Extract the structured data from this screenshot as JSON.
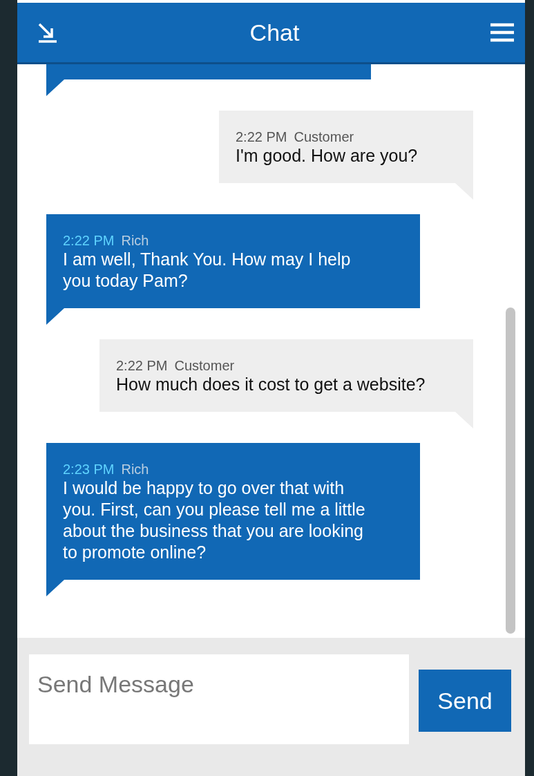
{
  "window": {
    "title": "Chat"
  },
  "messages": [
    {
      "kind": "customer",
      "time": "2:22 PM",
      "sender": "Customer",
      "text": "I'm good. How are you?"
    },
    {
      "kind": "agent",
      "time": "2:22 PM",
      "sender": "Rich",
      "text": "I am well, Thank You. How may I help you today Pam?"
    },
    {
      "kind": "customer",
      "time": "2:22 PM",
      "sender": "Customer",
      "text": "How much does it cost to get a website?"
    },
    {
      "kind": "agent",
      "time": "2:23 PM",
      "sender": "Rich",
      "text": "I would be happy to go over that with you. First, can you please tell me a little about the business that you are looking to promote online?"
    }
  ],
  "composer": {
    "placeholder": "Send Message",
    "button": "Send"
  }
}
